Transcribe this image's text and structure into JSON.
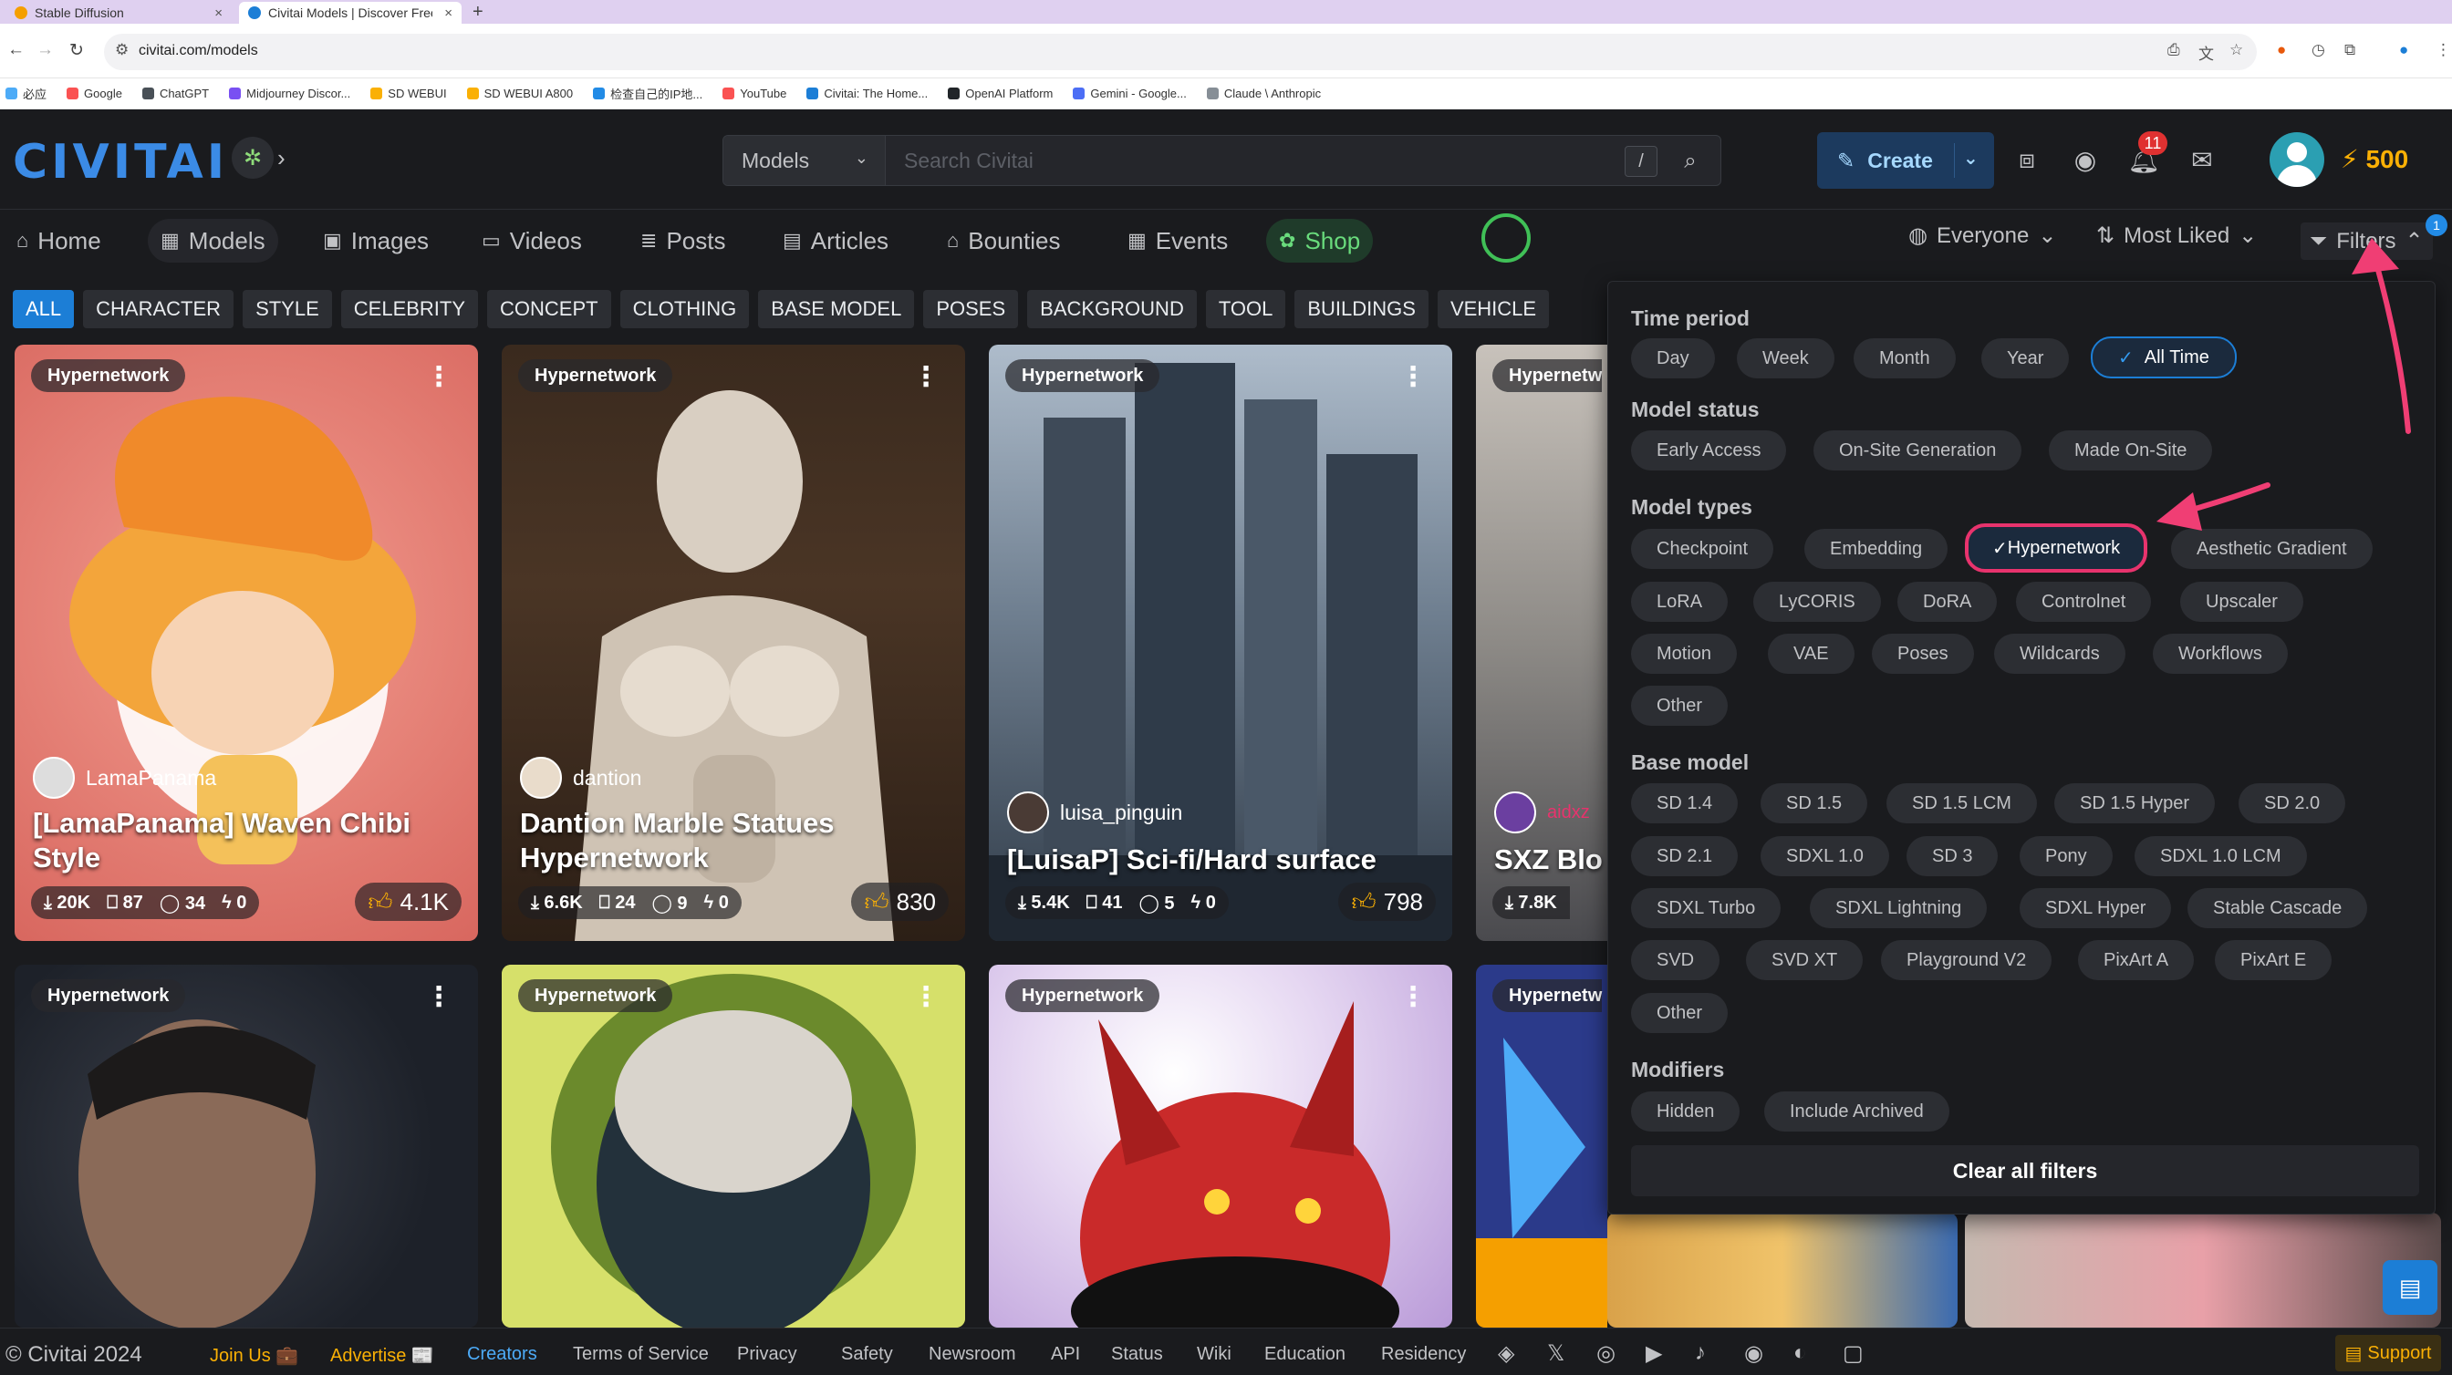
{
  "browser": {
    "tabs": [
      {
        "title": "Stable Diffusion",
        "close": "×"
      },
      {
        "title": "Civitai Models | Discover Free",
        "close": "×"
      }
    ],
    "new_tab": "+",
    "url": "civitai.com/models",
    "bookmarks": [
      "必应",
      "Google",
      "ChatGPT",
      "Midjourney Discor...",
      "SD WEBUI",
      "SD WEBUI A800",
      "检查自己的IP地...",
      "YouTube",
      "Civitai: The Home...",
      "OpenAI Platform",
      "Gemini - Google...",
      "Claude \\ Anthropic"
    ]
  },
  "header": {
    "logo": "CIVITAI",
    "search": {
      "scope": "Models",
      "placeholder": "Search Civitai",
      "shortcut": "/"
    },
    "create_label": "Create",
    "notifications_count": "11",
    "buzz_amount": "500"
  },
  "nav": {
    "items": [
      "Home",
      "Models",
      "Images",
      "Videos",
      "Posts",
      "Articles",
      "Bounties",
      "Events",
      "Shop"
    ],
    "audience": "Everyone",
    "sort": "Most Liked",
    "filters_label": "Filters",
    "filters_badge": "1"
  },
  "categories": [
    "ALL",
    "CHARACTER",
    "STYLE",
    "CELEBRITY",
    "CONCEPT",
    "CLOTHING",
    "BASE MODEL",
    "POSES",
    "BACKGROUND",
    "TOOL",
    "BUILDINGS",
    "VEHICLE"
  ],
  "cards": [
    {
      "tag": "Hypernetwork",
      "user": "LamaPanama",
      "title": "[LamaPanama] Waven Chibi Style",
      "downloads": "20K",
      "saves": "87",
      "comments": "34",
      "buzz": "0",
      "likes": "4.1K"
    },
    {
      "tag": "Hypernetwork",
      "user": "dantion",
      "title": "Dantion Marble Statues Hypernetwork",
      "downloads": "6.6K",
      "saves": "24",
      "comments": "9",
      "buzz": "0",
      "likes": "830"
    },
    {
      "tag": "Hypernetwork",
      "user": "luisa_pinguin",
      "title": "[LuisaP] Sci-fi/Hard surface",
      "downloads": "5.4K",
      "saves": "41",
      "comments": "5",
      "buzz": "0",
      "likes": "798"
    },
    {
      "tag": "Hypernetw",
      "user": "aidxz",
      "title": "SXZ Blo",
      "downloads": "7.8K"
    },
    {
      "tag": "Hypernetwork"
    },
    {
      "tag": "Hypernetwork"
    },
    {
      "tag": "Hypernetwork"
    },
    {
      "tag": "Hypernetw"
    }
  ],
  "filters": {
    "time_period": {
      "title": "Time period",
      "options": [
        "Day",
        "Week",
        "Month",
        "Year",
        "All Time"
      ],
      "selected": "All Time"
    },
    "model_status": {
      "title": "Model status",
      "options": [
        "Early Access",
        "On-Site Generation",
        "Made On-Site"
      ]
    },
    "model_types": {
      "title": "Model types",
      "options": [
        "Checkpoint",
        "Embedding",
        "Hypernetwork",
        "Aesthetic Gradient",
        "LoRA",
        "LyCORIS",
        "DoRA",
        "Controlnet",
        "Upscaler",
        "Motion",
        "VAE",
        "Poses",
        "Wildcards",
        "Workflows",
        "Other"
      ],
      "selected": "Hypernetwork"
    },
    "base_model": {
      "title": "Base model",
      "options": [
        "SD 1.4",
        "SD 1.5",
        "SD 1.5 LCM",
        "SD 1.5 Hyper",
        "SD 2.0",
        "SD 2.1",
        "SDXL 1.0",
        "SD 3",
        "Pony",
        "SDXL 1.0 LCM",
        "SDXL Turbo",
        "SDXL Lightning",
        "SDXL Hyper",
        "Stable Cascade",
        "SVD",
        "SVD XT",
        "Playground V2",
        "PixArt A",
        "PixArt E",
        "Other"
      ]
    },
    "modifiers": {
      "title": "Modifiers",
      "options": [
        "Hidden",
        "Include Archived"
      ]
    },
    "clear_label": "Clear all filters"
  },
  "footer": {
    "links": [
      "© Civitai 2024",
      "Join Us 💼",
      "Advertise 📰",
      "Creators",
      "Terms of Service",
      "Privacy",
      "Safety",
      "Newsroom",
      "API",
      "Status",
      "Wiki",
      "Education",
      "Residency"
    ],
    "support": "Support"
  },
  "colors": {
    "accent": "#1c7ed6",
    "highlight": "#e8336d",
    "shop": "#69db7c",
    "buzz": "#fab005"
  }
}
